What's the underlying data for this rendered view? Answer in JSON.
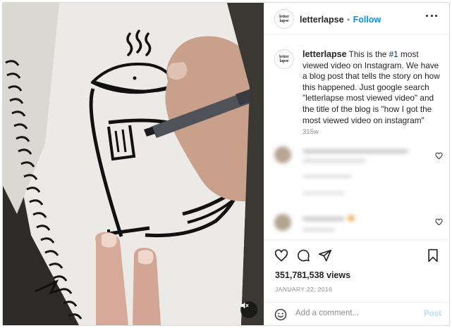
{
  "post": {
    "author": "letterlapse",
    "avatar_text": "letter lapse",
    "follow_label": "Follow",
    "separator": "•",
    "caption": {
      "username": "letterlapse",
      "text_before_hashtag": "This is the ",
      "hashtag": "#1",
      "text_after_hashtag": " most viewed video on Instagram. We have a blog post that tells the story on how this happened. Just google search \"letterlapse most viewed video\" and the title of the blog is \"how I got the most viewed video on instagram\""
    },
    "time_ago": "315w",
    "views": "351,781,538 views",
    "date": "JANUARY 22, 2016"
  },
  "comment_box": {
    "placeholder": "Add a comment...",
    "post_label": "Post"
  },
  "colors": {
    "accent": "#0095f6",
    "post_disabled": "#b2dffc",
    "text": "#262626",
    "muted": "#8e8e8e"
  },
  "icons": [
    "emoji-icon",
    "heart-icon",
    "comment-icon",
    "share-icon",
    "bookmark-icon",
    "more-icon",
    "volume-muted-icon"
  ]
}
